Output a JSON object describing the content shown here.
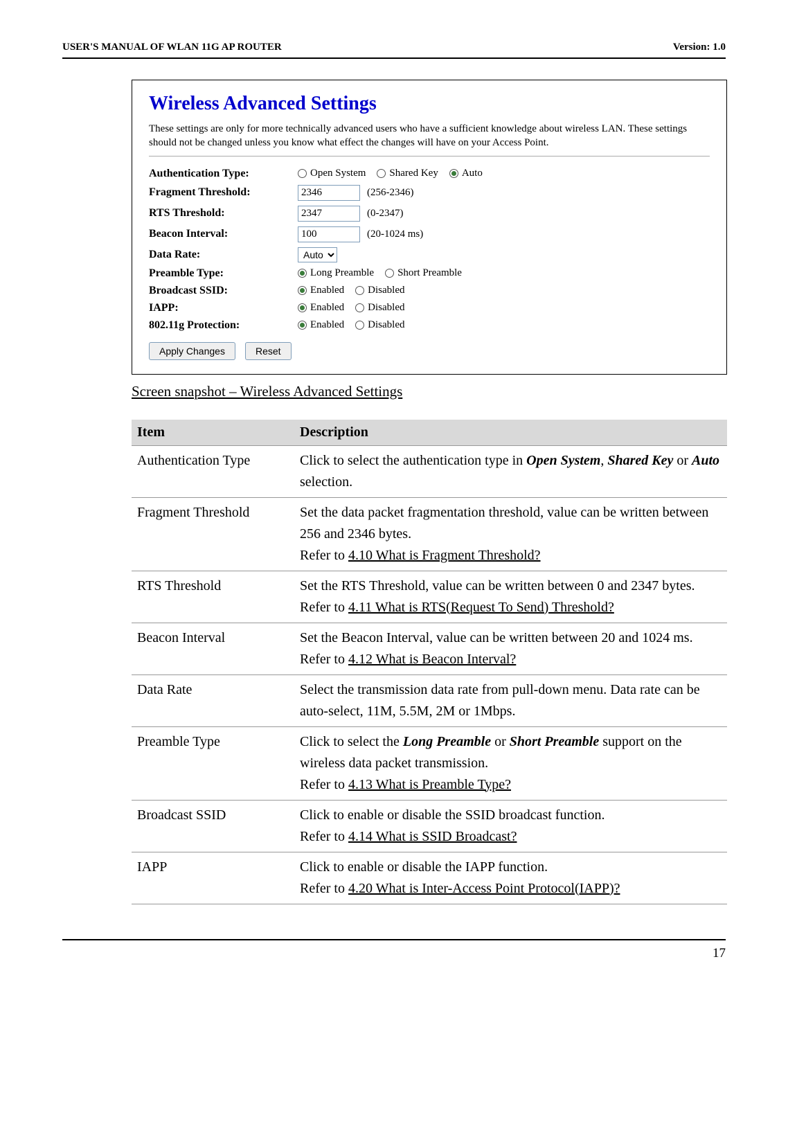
{
  "header": {
    "left": "USER'S MANUAL OF WLAN 11G AP ROUTER",
    "right": "Version: 1.0"
  },
  "settings": {
    "title": "Wireless Advanced Settings",
    "intro": "These settings are only for more technically advanced users who have a sufficient knowledge about wireless LAN. These settings should not be changed unless you know what effect the changes will have on your Access Point.",
    "rows": {
      "auth": {
        "label": "Authentication Type:",
        "opts": [
          "Open System",
          "Shared Key",
          "Auto"
        ],
        "selected": 2
      },
      "frag": {
        "label": "Fragment Threshold:",
        "value": "2346",
        "hint": "(256-2346)"
      },
      "rts": {
        "label": "RTS Threshold:",
        "value": "2347",
        "hint": "(0-2347)"
      },
      "beacon": {
        "label": "Beacon Interval:",
        "value": "100",
        "hint": "(20-1024 ms)"
      },
      "rate": {
        "label": "Data Rate:",
        "value": "Auto"
      },
      "preamble": {
        "label": "Preamble Type:",
        "opts": [
          "Long Preamble",
          "Short Preamble"
        ],
        "selected": 0
      },
      "bssid": {
        "label": "Broadcast SSID:",
        "opts": [
          "Enabled",
          "Disabled"
        ],
        "selected": 0
      },
      "iapp": {
        "label": "IAPP:",
        "opts": [
          "Enabled",
          "Disabled"
        ],
        "selected": 0
      },
      "prot": {
        "label": "802.11g Protection:",
        "opts": [
          "Enabled",
          "Disabled"
        ],
        "selected": 0
      }
    },
    "buttons": {
      "apply": "Apply Changes",
      "reset": "Reset"
    }
  },
  "caption": "Screen snapshot – Wireless Advanced Settings",
  "table": {
    "headers": [
      "Item",
      "Description"
    ],
    "rows": [
      {
        "item": "Authentication Type",
        "desc": "Click to select the authentication type in <span class='bi'>Open System</span>, <span class='bi'>Shared Key</span> or <span class='bi'>Auto</span> selection."
      },
      {
        "item": "Fragment Threshold",
        "desc": "Set the data packet fragmentation threshold, value can be written between 256 and 2346 bytes.<br>Refer to <span class='ul'>4.10 What is Fragment Threshold?</span>"
      },
      {
        "item": "RTS Threshold",
        "desc": "Set the RTS Threshold, value can be written between 0 and 2347 bytes.<br>Refer to <span class='ul'>4.11 What is RTS(Request To Send) Threshold?</span>"
      },
      {
        "item": "Beacon Interval",
        "desc": "Set the Beacon Interval, value can be written between 20 and 1024 ms.<br>Refer to <span class='ul'>4.12 What is Beacon Interval?</span>"
      },
      {
        "item": "Data Rate",
        "desc": "Select the transmission data rate from pull-down menu. Data rate can be auto-select, 11M, 5.5M, 2M or 1Mbps."
      },
      {
        "item": "Preamble Type",
        "desc": "Click to select the <span class='bi'>Long Preamble</span> or <span class='bi'>Short Preamble</span> support on the wireless data packet transmission.<br>Refer to <span class='ul'>4.13 What is Preamble Type?</span>"
      },
      {
        "item": "Broadcast SSID",
        "desc": "Click to enable or disable the SSID broadcast function.<br>Refer to <span class='ul'>4.14 What is SSID Broadcast?</span>"
      },
      {
        "item": "IAPP",
        "desc": "Click to enable or disable the IAPP function.<br>Refer to <span class='ul'>4.20 What is Inter-Access Point Protocol(IAPP)?</span>"
      }
    ]
  },
  "footer": {
    "page": "17"
  }
}
